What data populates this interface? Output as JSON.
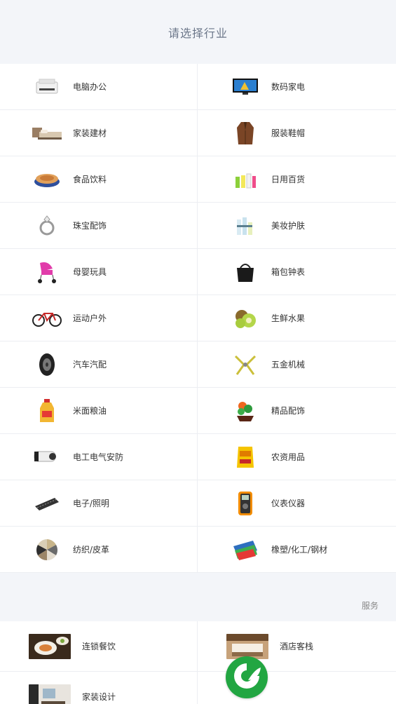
{
  "header": {
    "title": "请选择行业"
  },
  "industries": [
    {
      "label": "电脑办公",
      "icon": "printer-icon"
    },
    {
      "label": "数码家电",
      "icon": "tv-icon"
    },
    {
      "label": "家装建材",
      "icon": "bed-icon"
    },
    {
      "label": "服装鞋帽",
      "icon": "coat-icon"
    },
    {
      "label": "食品饮料",
      "icon": "food-tin-icon"
    },
    {
      "label": "日用百货",
      "icon": "bottles-icon"
    },
    {
      "label": "珠宝配饰",
      "icon": "ring-icon"
    },
    {
      "label": "美妆护肤",
      "icon": "cosmetics-icon"
    },
    {
      "label": "母婴玩具",
      "icon": "stroller-icon"
    },
    {
      "label": "箱包钟表",
      "icon": "handbag-icon"
    },
    {
      "label": "运动户外",
      "icon": "bicycle-icon"
    },
    {
      "label": "生鲜水果",
      "icon": "kiwi-icon"
    },
    {
      "label": "汽车汽配",
      "icon": "tire-icon"
    },
    {
      "label": "五金机械",
      "icon": "pliers-icon"
    },
    {
      "label": "米面粮油",
      "icon": "oil-bottle-icon"
    },
    {
      "label": "精品配饰",
      "icon": "flower-pot-icon"
    },
    {
      "label": "电工电气安防",
      "icon": "cctv-camera-icon"
    },
    {
      "label": "农资用品",
      "icon": "seed-bag-icon"
    },
    {
      "label": "电子/照明",
      "icon": "chip-icon"
    },
    {
      "label": "仪表仪器",
      "icon": "multimeter-icon"
    },
    {
      "label": "纺织/皮革",
      "icon": "fabric-swatch-icon"
    },
    {
      "label": "橡塑/化工/钢材",
      "icon": "plastic-sheets-icon"
    }
  ],
  "services_section": {
    "label": "服务"
  },
  "services": [
    {
      "label": "连锁餐饮",
      "icon": "restaurant-photo"
    },
    {
      "label": "酒店客栈",
      "icon": "hotel-photo"
    },
    {
      "label": "家装设计",
      "icon": "interior-photo"
    }
  ],
  "fab": {
    "icon": "leaf-logo-icon"
  },
  "colors": {
    "header_bg": "#f3f5f9",
    "title": "#6b7689",
    "fab": "#22a642"
  }
}
